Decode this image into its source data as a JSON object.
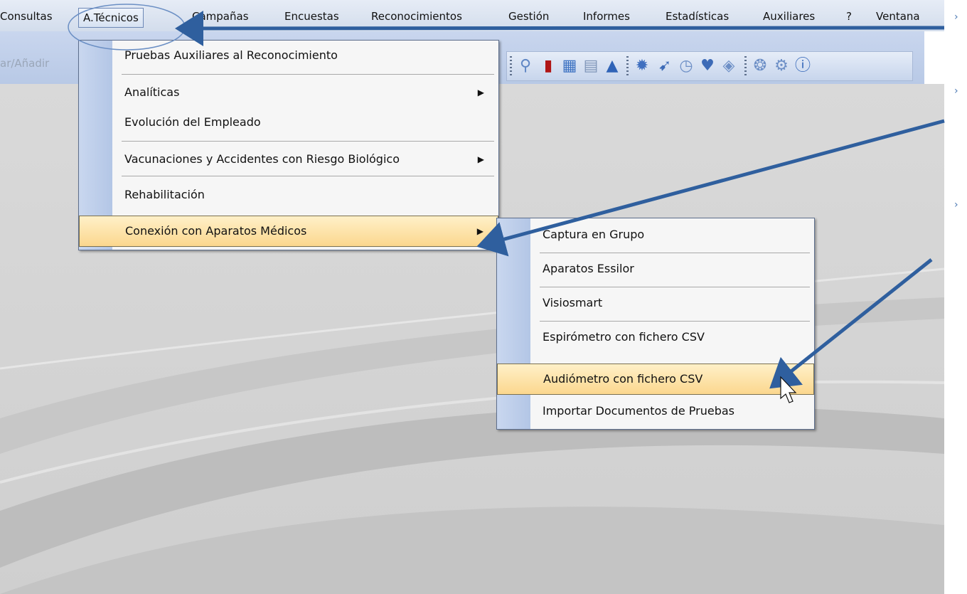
{
  "menubar": {
    "items": [
      {
        "label": "Consultas"
      },
      {
        "label": "A.Técnicos"
      },
      {
        "label": "Campañas"
      },
      {
        "label": "Encuestas"
      },
      {
        "label": "Reconocimientos"
      },
      {
        "label": "Gestión"
      },
      {
        "label": "Informes"
      },
      {
        "label": "Estadísticas"
      },
      {
        "label": "Auxiliares"
      },
      {
        "label": "?"
      },
      {
        "label": "Ventana"
      }
    ]
  },
  "toolbar": {
    "text": "ar/Añadir",
    "icons": [
      "lightbulb-icon",
      "book-icon",
      "calendar-icon",
      "clipboard-icon",
      "warning-icon",
      "gear-icon",
      "send-icon",
      "clock-icon",
      "heart-icon",
      "pill-icon",
      "lifebuoy-icon",
      "settings-icon",
      "info-icon"
    ]
  },
  "atecnicos_menu": {
    "items": [
      {
        "label": "Pruebas Auxiliares al Reconocimiento",
        "submenu": false
      },
      {
        "label": "Analíticas",
        "submenu": true
      },
      {
        "label": "Evolución del Empleado",
        "submenu": false
      },
      {
        "label": "Vacunaciones y Accidentes con Riesgo Biológico",
        "submenu": true
      },
      {
        "label": "Rehabilitación",
        "submenu": false
      },
      {
        "label": "Conexión con Aparatos Médicos",
        "submenu": true,
        "highlighted": true
      }
    ]
  },
  "submenu": {
    "items": [
      {
        "label": "Captura en Grupo"
      },
      {
        "label": "Aparatos Essilor"
      },
      {
        "label": "Visiosmart"
      },
      {
        "label": "Espirómetro con fichero CSV"
      },
      {
        "label": "Audiómetro con fichero CSV",
        "highlighted": true
      },
      {
        "label": "Importar Documentos de Pruebas"
      }
    ]
  },
  "colors": {
    "accent_arrow": "#2f5f9e",
    "highlight_top": "#fff0c8",
    "highlight_bottom": "#fbd78e",
    "gutter": "#b3c6e6"
  }
}
